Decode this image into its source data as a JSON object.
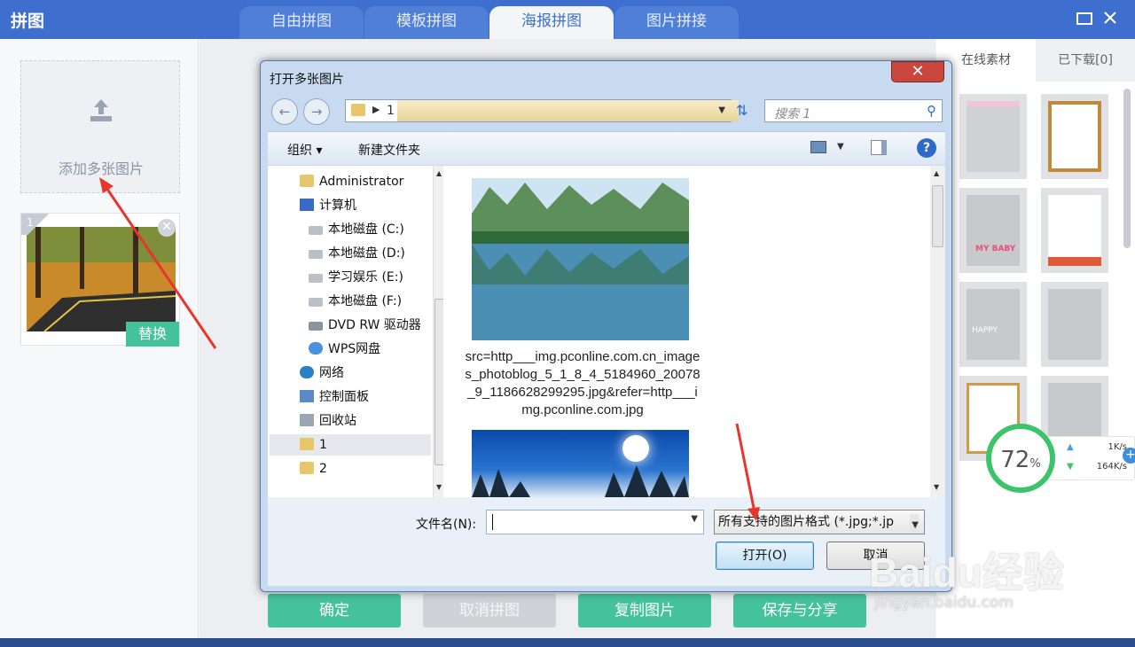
{
  "app": {
    "title": "拼图",
    "tabs": [
      "自由拼图",
      "模板拼图",
      "海报拼图",
      "图片拼接"
    ],
    "active_tab": "海报拼图",
    "maximize_icon": "maximize-icon",
    "close_icon": "close-icon"
  },
  "left_panel": {
    "add_label": "添加多张图片",
    "thumb_number": "1",
    "replace_label": "替换"
  },
  "right_panel": {
    "tabs": [
      "在线素材",
      "已下载[0]"
    ],
    "template_texts": [
      "MY BABY",
      "HAPPY"
    ],
    "speed": {
      "percent": "72",
      "percent_unit": "%",
      "up": "1K/s",
      "down": "164K/s"
    }
  },
  "bottom_buttons": [
    "确定",
    "取消拼图",
    "复制图片",
    "保存与分享"
  ],
  "dialog": {
    "title": "打开多张图片",
    "close_label": "✕",
    "address": "1",
    "search_placeholder": "搜索 1",
    "toolbar": {
      "organize": "组织 ▾",
      "new_folder": "新建文件夹"
    },
    "tree": [
      {
        "label": "Administrator",
        "icon": "user-folder-icon"
      },
      {
        "label": "计算机",
        "icon": "computer-icon"
      },
      {
        "label": "本地磁盘 (C:)",
        "icon": "drive-icon"
      },
      {
        "label": "本地磁盘 (D:)",
        "icon": "drive-icon"
      },
      {
        "label": "学习娱乐 (E:)",
        "icon": "drive-icon"
      },
      {
        "label": "本地磁盘 (F:)",
        "icon": "drive-icon"
      },
      {
        "label": "DVD RW 驱动器",
        "icon": "dvd-icon"
      },
      {
        "label": "WPS网盘",
        "icon": "cloud-icon"
      },
      {
        "label": "网络",
        "icon": "network-icon"
      },
      {
        "label": "控制面板",
        "icon": "control-panel-icon"
      },
      {
        "label": "回收站",
        "icon": "recycle-bin-icon"
      },
      {
        "label": "1",
        "icon": "folder-icon"
      },
      {
        "label": "2",
        "icon": "folder-icon"
      }
    ],
    "selected_tree_item": "1",
    "file_caption": "src=http___img.pconline.com.cn_images_photoblog_5_1_8_4_5184960_20078_9_1186628299295.jpg&refer=http___img.pconline.com.jpg",
    "filename_label": "文件名(N):",
    "filename_value": "",
    "filetype_value": "所有支持的图片格式 (*.jpg;*.jp",
    "open_label": "打开(O)",
    "cancel_label": "取消"
  },
  "watermark": {
    "main": "Baidu经验",
    "sub": "jingyan.baidu.com"
  }
}
